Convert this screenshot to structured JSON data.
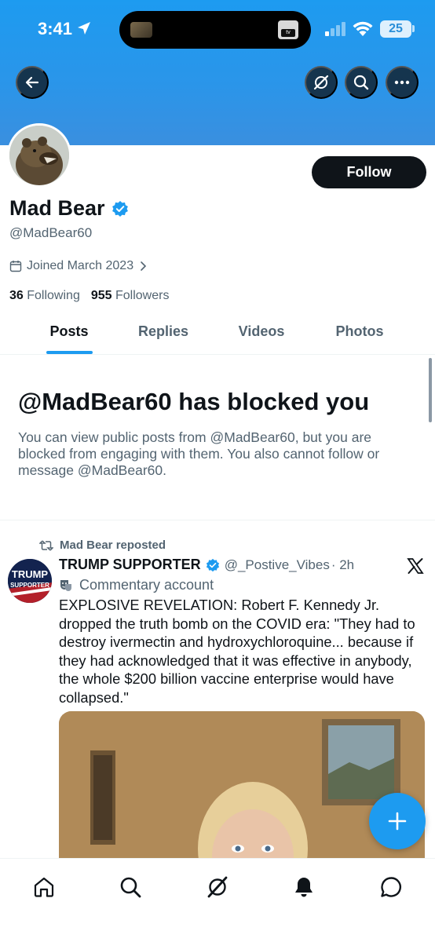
{
  "status_bar": {
    "time": "3:41",
    "battery": "25"
  },
  "header": {
    "back_icon": "back-arrow-icon",
    "grok_icon": "grok-icon",
    "search_icon": "search-icon",
    "more_icon": "more-icon"
  },
  "profile": {
    "name": "Mad Bear",
    "handle": "@MadBear60",
    "joined": "Joined March 2023",
    "following_count": "36",
    "following_label": "Following",
    "followers_count": "955",
    "followers_label": "Followers",
    "follow_label": "Follow",
    "verified": true
  },
  "tabs": [
    {
      "label": "Posts",
      "active": true
    },
    {
      "label": "Replies",
      "active": false
    },
    {
      "label": "Videos",
      "active": false
    },
    {
      "label": "Photos",
      "active": false
    }
  ],
  "blocked": {
    "title": "@MadBear60 has blocked you",
    "message": "You can view public posts from @MadBear60, but you are blocked from engaging with them. You also cannot follow or message @MadBear60."
  },
  "post": {
    "repost_label": "Mad Bear reposted",
    "author_name": "TRUMP SUPPORTER",
    "author_handle": "@_Postive_Vibes",
    "time": "· 2h",
    "commentary_label": "Commentary account",
    "text": "EXPLOSIVE REVELATION: Robert F. Kennedy Jr. dropped the truth bomb on the COVID era: \"They had to destroy ivermectin and hydroxychloroquine... because if they had acknowledged that it was effective in anybody, the whole $200 billion vaccine enterprise would have collapsed.\"",
    "avatar_text_line1": "TRUMP",
    "avatar_text_line2": "SUPPORTER"
  },
  "bottom_nav": [
    "home-icon",
    "search-icon",
    "grok-icon",
    "notifications-icon",
    "messages-icon"
  ],
  "colors": {
    "accent": "#1d9bf0",
    "text_primary": "#0f1419",
    "text_secondary": "#536471"
  }
}
